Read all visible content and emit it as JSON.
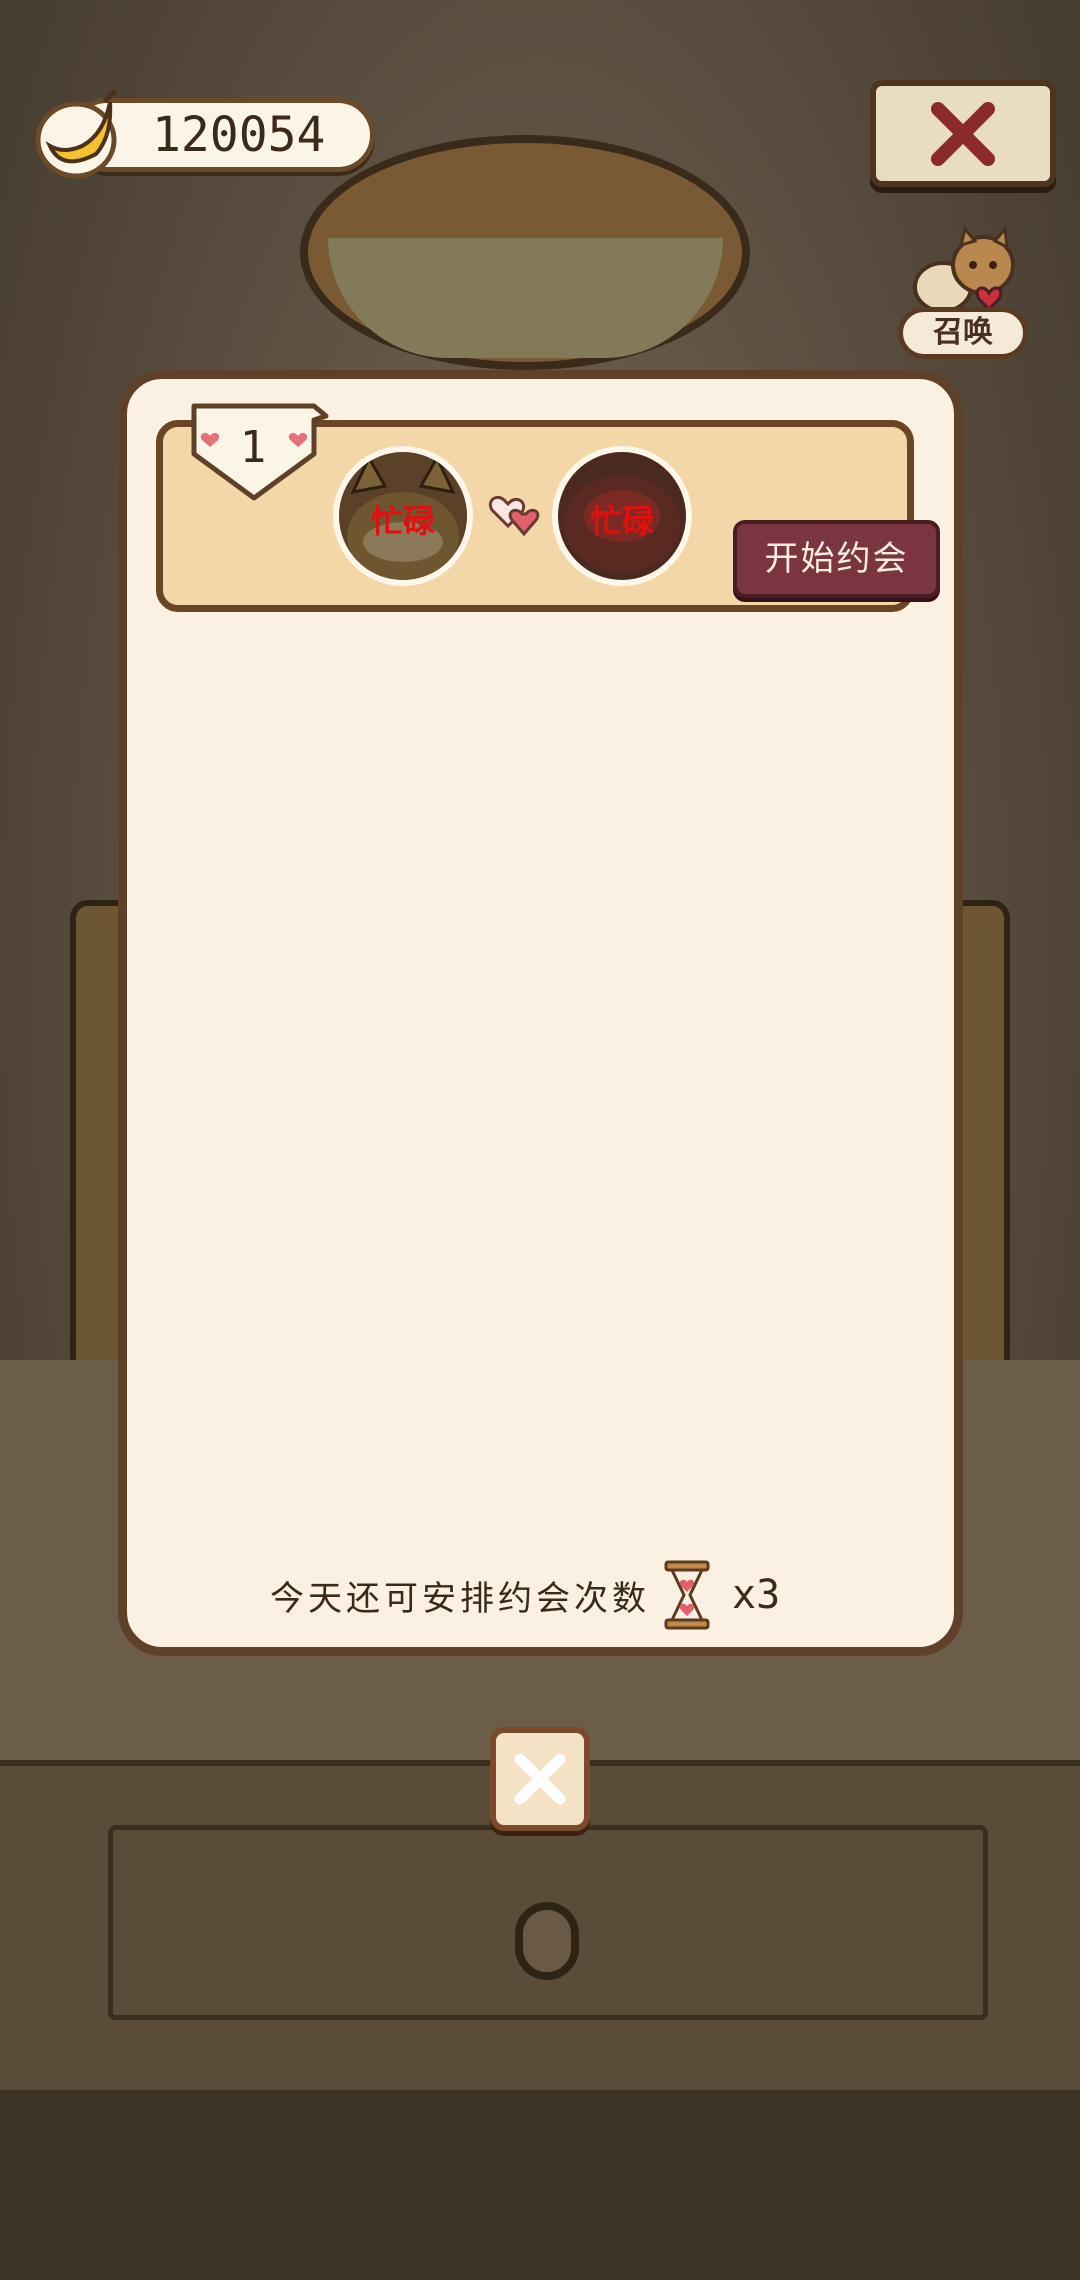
{
  "currency": {
    "value": "120054",
    "icon": "banana-icon"
  },
  "summon": {
    "label": "召唤",
    "icon": "cats-icon"
  },
  "pairing": {
    "rank": "1",
    "left_status": "忙碌",
    "right_status": "忙碌",
    "start_button": "开始约会"
  },
  "footer": {
    "remaining_text": "今天还可安排约会次数",
    "remaining_count": "x3",
    "icon": "hourglass-icon"
  },
  "colors": {
    "panel": "#fbf1e2",
    "card": "#f3d7a8",
    "button": "#7a3540",
    "busy": "#e11010"
  }
}
